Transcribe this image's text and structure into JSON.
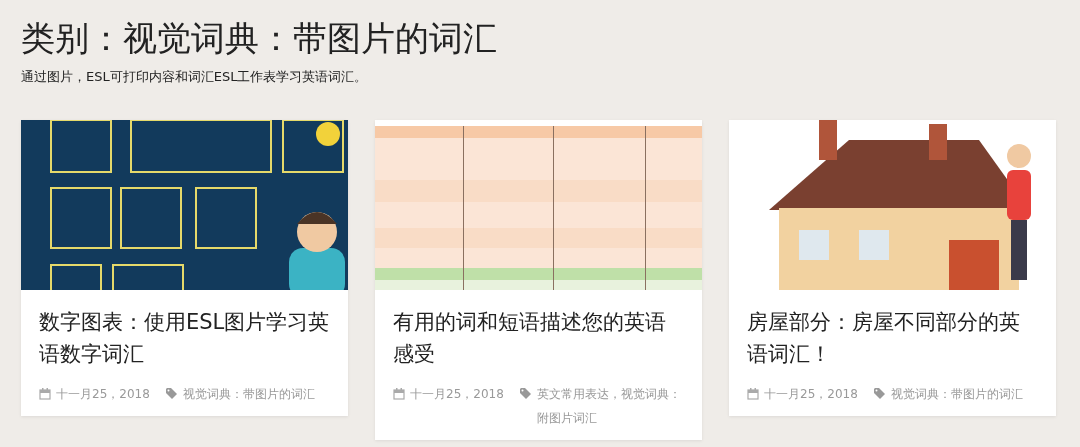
{
  "page": {
    "title": "类别：视觉词典：带图片的词汇",
    "description": "通过图片，ESL可打印内容和词汇ESL工作表学习英语词汇。"
  },
  "posts": [
    {
      "title": "数字图表：使用ESL图片学习英语数字词汇",
      "date": "十一月25，2018",
      "tags": "视觉词典：带图片的词汇"
    },
    {
      "title": "有用的词和短语描述您的英语感受",
      "date": "十一月25，2018",
      "tags": "英文常用表达，视觉词典：附图片词汇"
    },
    {
      "title": "房屋部分：房屋不同部分的英语词汇！",
      "date": "十一月25，2018",
      "tags": "视觉词典：带图片的词汇"
    }
  ]
}
